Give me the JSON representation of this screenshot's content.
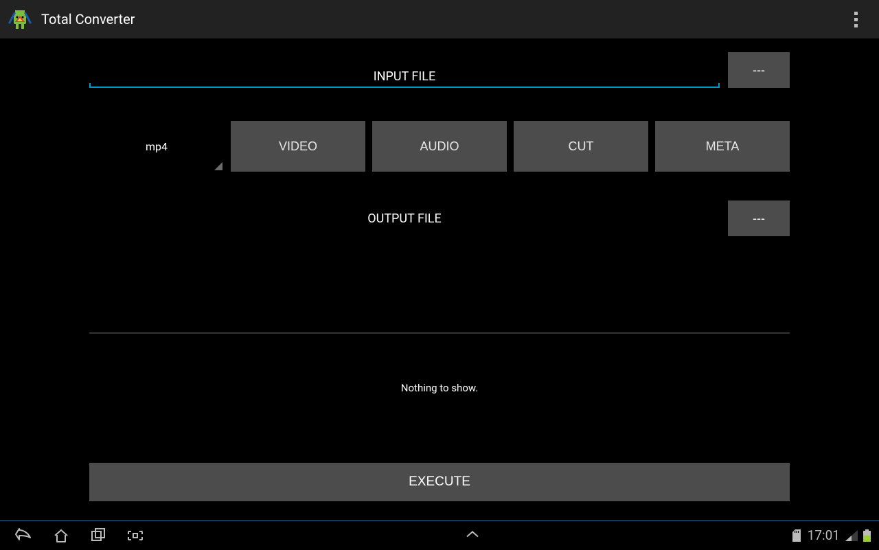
{
  "appbar": {
    "title": "Total Converter",
    "overflow_icon": "more-vert-icon"
  },
  "input": {
    "label": "INPUT FILE",
    "browse_button": "---"
  },
  "spinner": {
    "value": "mp4"
  },
  "tabs": {
    "video": "VIDEO",
    "audio": "AUDIO",
    "cut": "CUT",
    "meta": "META"
  },
  "output": {
    "label": "OUTPUT FILE",
    "browse_button": "---"
  },
  "status_text": "Nothing to show.",
  "execute_button": "EXECUTE",
  "system": {
    "clock": "17:01"
  }
}
